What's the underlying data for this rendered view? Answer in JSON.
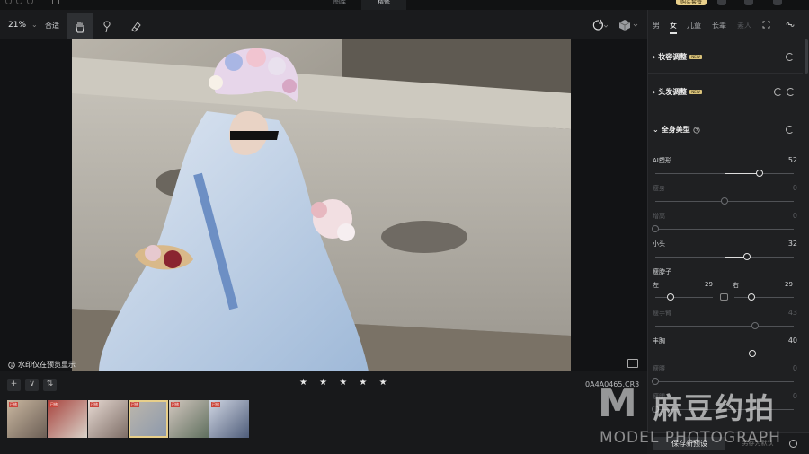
{
  "titlebar": {
    "tabs": [
      "图库",
      "精修"
    ],
    "active_tab": "精修",
    "buy_label": "购买套餐"
  },
  "toolbar": {
    "zoom": "21%",
    "fit_label": "合适",
    "tools": [
      "hand-icon",
      "lasso-brush-icon",
      "eraser-icon"
    ],
    "active_tool": "hand-icon"
  },
  "canvas": {
    "watermark_note": "水印仅在预览显示"
  },
  "filmstrip": {
    "rating": "★ ★ ★ ★ ★",
    "filename": "0A4A0465.CR3",
    "thumb_tag": "已修",
    "thumb_count": 6,
    "selected_index": 3
  },
  "panel": {
    "gender_tabs": [
      "男",
      "女",
      "儿童",
      "长辈",
      "素人"
    ],
    "active_gender": "女",
    "sections": {
      "makeup": {
        "title": "妆容调整",
        "badge": "NEW"
      },
      "hair": {
        "title": "头发调整",
        "badge": "NEW"
      },
      "body": {
        "title": "全身美型"
      }
    },
    "sliders": [
      {
        "label": "AI塑形",
        "value": "52",
        "level": 0.75,
        "enabled": true
      },
      {
        "label": "瘦身",
        "value": "0",
        "level": 0.5,
        "enabled": false
      },
      {
        "label": "增高",
        "value": "0",
        "level": 0.0,
        "enabled": false
      },
      {
        "label": "小头",
        "value": "32",
        "level": 0.66,
        "enabled": true
      },
      {
        "label": "瘦手臂",
        "value": "43",
        "level": 0.72,
        "enabled": false
      },
      {
        "label": "丰胸",
        "value": "40",
        "level": 0.7,
        "enabled": true
      },
      {
        "label": "瘦腰",
        "value": "0",
        "level": 0.0,
        "enabled": false
      },
      {
        "label": "瘦腿",
        "value": "0",
        "level": 0.0,
        "enabled": false
      }
    ],
    "neck": {
      "label": "瘦脖子",
      "left_label": "左",
      "left_value": "29",
      "right_label": "右",
      "right_value": "29"
    },
    "save_preset": "保存新预设",
    "save_preset2": "另存为默认"
  },
  "brand": {
    "chinese": "麻豆约拍",
    "english": "MODEL PHOTOGRAPH"
  },
  "colors": {
    "accent": "#e8cf8a",
    "panel_bg": "#1f2022",
    "canvas_bg": "#121315"
  }
}
